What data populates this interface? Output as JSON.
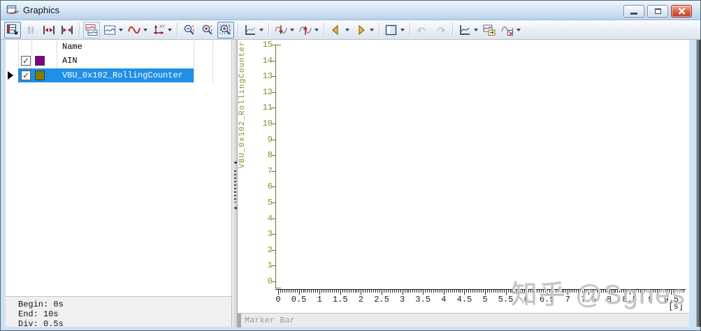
{
  "window": {
    "title": "Graphics"
  },
  "titlebar": {
    "buttons": [
      {
        "name": "minimize-button"
      },
      {
        "name": "maximize-button"
      },
      {
        "name": "close-button"
      }
    ]
  },
  "toolbar": {
    "icons": [
      {
        "name": "show-signal-list-toggle",
        "active": true
      },
      {
        "name": "pause-button",
        "disabled": true
      },
      {
        "name": "expand-time-range-button"
      },
      {
        "name": "compress-time-range-button"
      },
      {
        "sep": true
      },
      {
        "name": "stacked-view-button",
        "highlight": true
      },
      {
        "name": "view-mode-dropdown",
        "dropdown": true
      },
      {
        "name": "signal-style-dropdown",
        "dropdown": true
      },
      {
        "name": "scale-xy-dropdown",
        "dropdown": true
      },
      {
        "sep": true
      },
      {
        "name": "zoom-out-button"
      },
      {
        "name": "zoom-in-button"
      },
      {
        "name": "zoom-rect-toggle",
        "active": true
      },
      {
        "sep": true
      },
      {
        "name": "fit-diagram-dropdown",
        "dropdown": true
      },
      {
        "sep": true
      },
      {
        "name": "signal-down-dropdown",
        "dropdown": true
      },
      {
        "name": "signal-up-dropdown",
        "dropdown": true
      },
      {
        "sep": true
      },
      {
        "name": "prev-event-dropdown",
        "dropdown": true
      },
      {
        "name": "next-event-dropdown",
        "dropdown": true
      },
      {
        "sep": true
      },
      {
        "name": "layout-dropdown",
        "dropdown": true
      },
      {
        "sep": true
      },
      {
        "name": "undo-button",
        "disabled": true
      },
      {
        "name": "redo-button",
        "disabled": true
      },
      {
        "sep": true
      },
      {
        "name": "diagram-options-dropdown",
        "dropdown": true
      },
      {
        "name": "copy-diagram-button"
      },
      {
        "name": "export-signals-dropdown",
        "dropdown": true
      }
    ]
  },
  "legend": {
    "header": {
      "name": "Name"
    },
    "rows": [
      {
        "name": "AIN",
        "checked": true,
        "color": "#800080",
        "selected": false
      },
      {
        "name": "VBU_0x102_RollingCounter",
        "checked": true,
        "color": "#808000",
        "selected": true
      }
    ],
    "info": {
      "begin": "Begin: 0s",
      "end": "End: 10s",
      "div": "Div: 0.5s"
    },
    "selection_color": "#1f8fe8"
  },
  "chart_data": {
    "type": "line",
    "title": "",
    "xlabel": "[s]",
    "ylabel": "VBU_0x102_RollingCounter",
    "xlim": [
      0,
      9.8
    ],
    "ylim": [
      0,
      15
    ],
    "y_tick_step": 1,
    "x_major_tick_step": 0.5,
    "x_minor_tick_step": 0.05,
    "x_last_labeled_tick": 9.5,
    "grid": false,
    "y_axis_color": "#74741c",
    "x_axis_color": "#222222",
    "series": [
      {
        "name": "AIN",
        "color": "#800080",
        "values": []
      },
      {
        "name": "VBU_0x102_RollingCounter",
        "color": "#808000",
        "values": []
      }
    ],
    "note_empty_plot": true
  },
  "marker_bar": {
    "label": "Marker Bar"
  },
  "watermark": {
    "text": "知乎 @Sgnes"
  }
}
